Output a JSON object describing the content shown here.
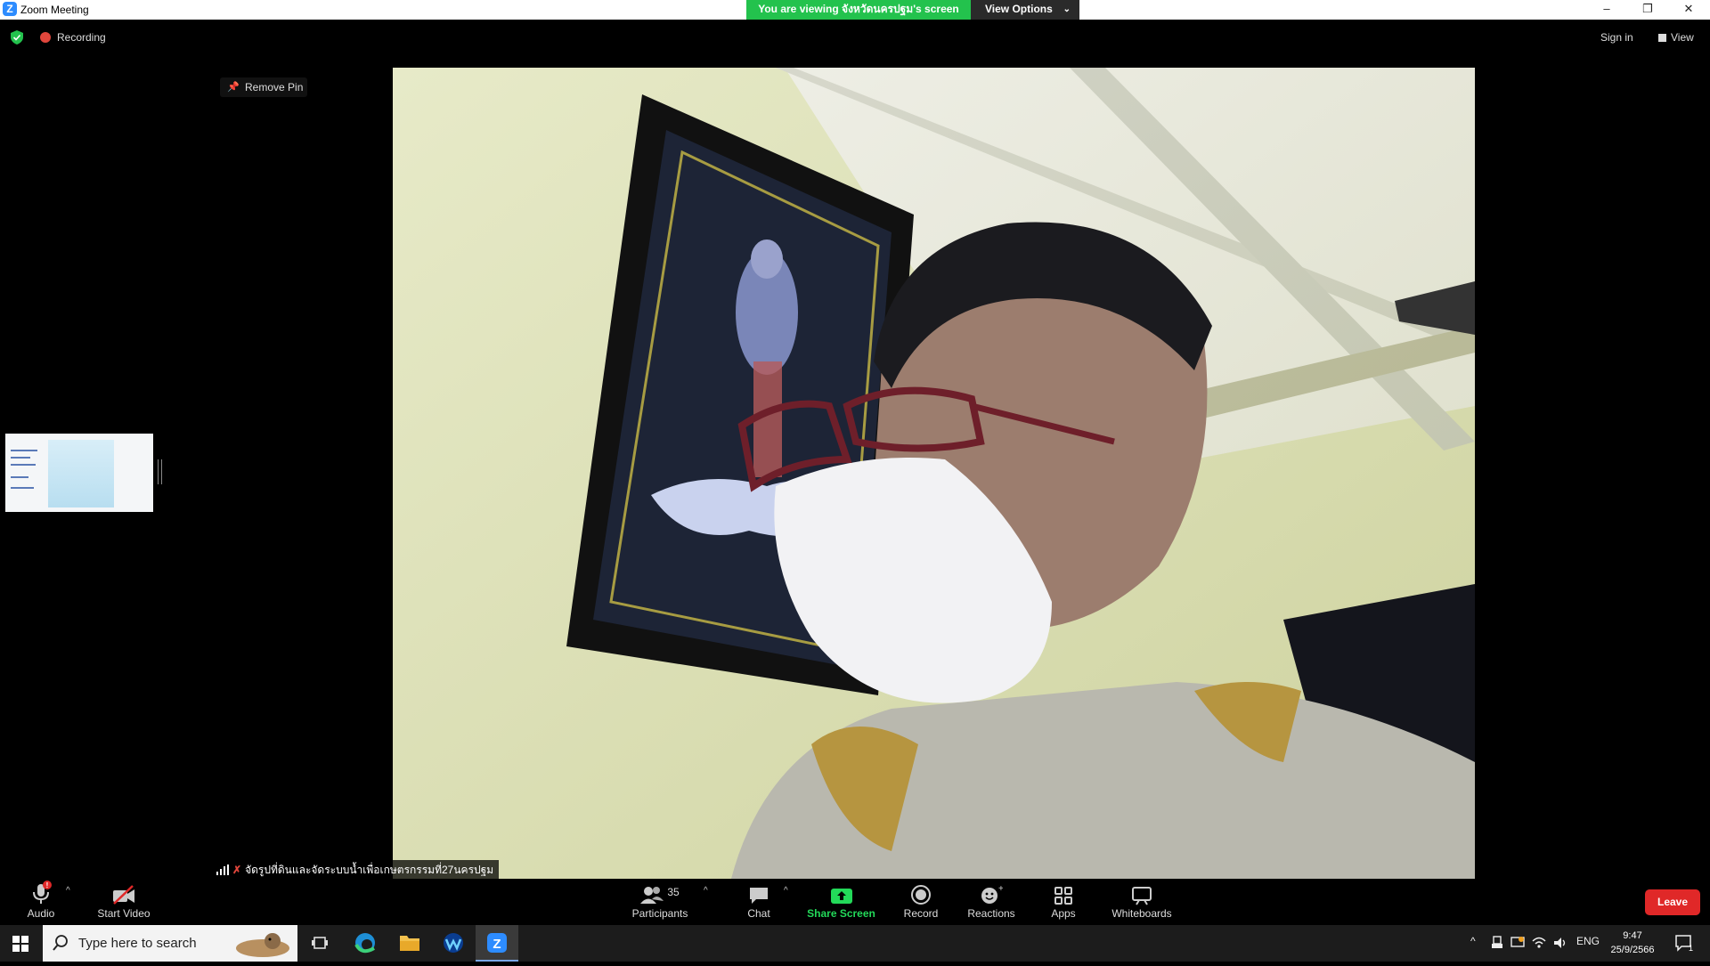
{
  "window": {
    "title": "Zoom Meeting",
    "controls": [
      "–",
      "❐",
      "✕"
    ]
  },
  "banner": {
    "viewing_text": "You are viewing จังหวัดนครปฐม's screen",
    "view_options_label": "View Options"
  },
  "meeting_status": {
    "recording_label": "Recording",
    "sign_in_label": "Sign in",
    "view_label": "View"
  },
  "pin": {
    "remove_pin_label": "Remove Pin"
  },
  "participant": {
    "name": "จัดรูปที่ดินและจัดระบบน้ำเพื่อเกษตรกรรมที่27นครปฐม"
  },
  "toolbar": {
    "audio_label": "Audio",
    "audio_badge": "!",
    "start_video_label": "Start Video",
    "participants_label": "Participants",
    "participants_count": "35",
    "chat_label": "Chat",
    "share_screen_label": "Share Screen",
    "record_label": "Record",
    "reactions_label": "Reactions",
    "apps_label": "Apps",
    "whiteboards_label": "Whiteboards",
    "leave_label": "Leave"
  },
  "taskbar": {
    "search_placeholder": "Type here to search",
    "language": "ENG",
    "time": "9:47",
    "date": "25/9/2566",
    "notification_count": "1"
  },
  "colors": {
    "banner_green": "#23c24d",
    "leave_red": "#e02828",
    "share_green": "#23d959",
    "zoom_blue": "#2d8cff"
  }
}
